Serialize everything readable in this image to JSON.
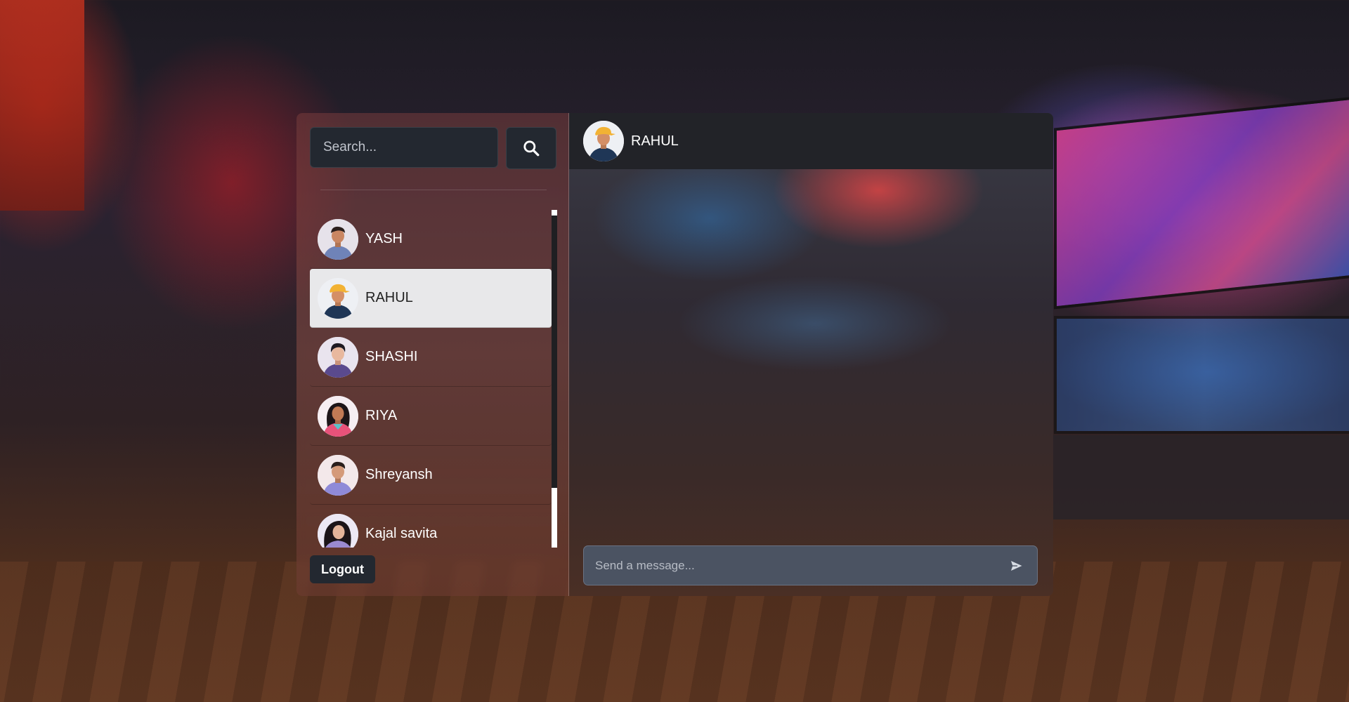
{
  "search": {
    "placeholder": "Search..."
  },
  "contacts": [
    {
      "name": "YASH",
      "avatar": "avatar-yash",
      "active": false
    },
    {
      "name": "RAHUL",
      "avatar": "avatar-rahul",
      "active": true
    },
    {
      "name": "SHASHI",
      "avatar": "avatar-shashi",
      "active": false
    },
    {
      "name": "RIYA",
      "avatar": "avatar-riya",
      "active": false
    },
    {
      "name": "Shreyansh",
      "avatar": "avatar-shreyansh",
      "active": false
    },
    {
      "name": "Kajal savita",
      "avatar": "avatar-kajal",
      "active": false
    }
  ],
  "sidebar": {
    "logout_label": "Logout"
  },
  "chat": {
    "header_name": "RAHUL",
    "message_placeholder": "Send a message..."
  },
  "icons": {
    "search": "search-icon",
    "send": "send-icon"
  },
  "colors": {
    "active_contact_bg": "#e8e8ea",
    "dark_control": "#232830",
    "header_bg": "#222328",
    "message_bar": "#4b5362"
  }
}
